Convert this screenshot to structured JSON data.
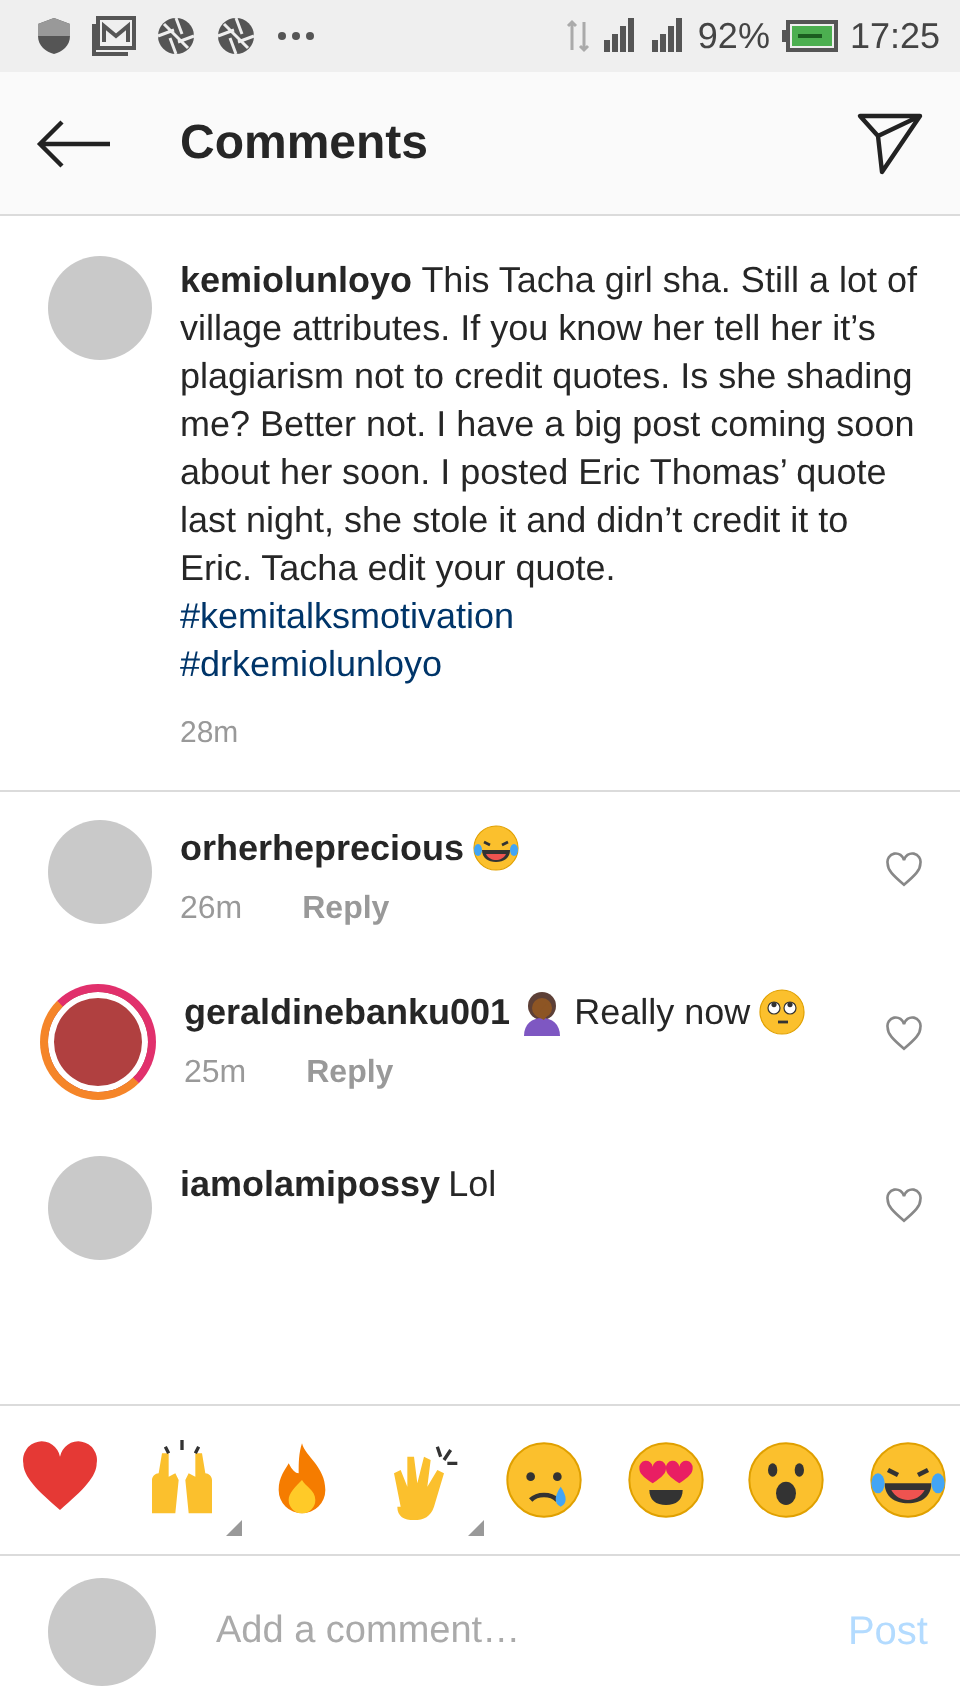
{
  "status_bar": {
    "battery": "92%",
    "time": "17:25"
  },
  "header": {
    "title": "Comments"
  },
  "caption": {
    "username": "kemiolunloyo",
    "text": "This Tacha girl sha. Still a lot of village attributes. If you know her tell her it’s plagiarism not to credit quotes. Is she shading me? Better not. I have a big post coming soon about her soon. I posted Eric Thomas’ quote last night, she stole it and didn’t credit it to Eric. Tacha edit your quote.",
    "hashtags": [
      "#kemitalksmotivation",
      "#drkemiolunloyo"
    ],
    "time": "28m"
  },
  "comments": [
    {
      "username": "orherheprecious",
      "parts": [
        {
          "kind": "emoji"
        }
      ],
      "time": "26m",
      "reply": "Reply",
      "story_ring": false,
      "liked": false
    },
    {
      "username": "geraldinebanku001",
      "parts": [
        {
          "kind": "emoji"
        },
        {
          "kind": "text",
          "text": "Really now"
        },
        {
          "kind": "emoji"
        }
      ],
      "time": "25m",
      "reply": "Reply",
      "story_ring": true,
      "liked": false
    },
    {
      "username": "iamolamipossy",
      "parts": [
        {
          "kind": "text",
          "text": "Lol"
        }
      ],
      "story_ring": false,
      "liked": false
    }
  ],
  "reactions": [
    {
      "variants": false
    },
    {
      "variants": true
    },
    {
      "variants": false
    },
    {
      "variants": true
    },
    {
      "variants": false
    },
    {
      "variants": false
    },
    {
      "variants": false
    },
    {
      "variants": false
    }
  ],
  "composer": {
    "placeholder": "Add a comment…",
    "post": "Post"
  }
}
